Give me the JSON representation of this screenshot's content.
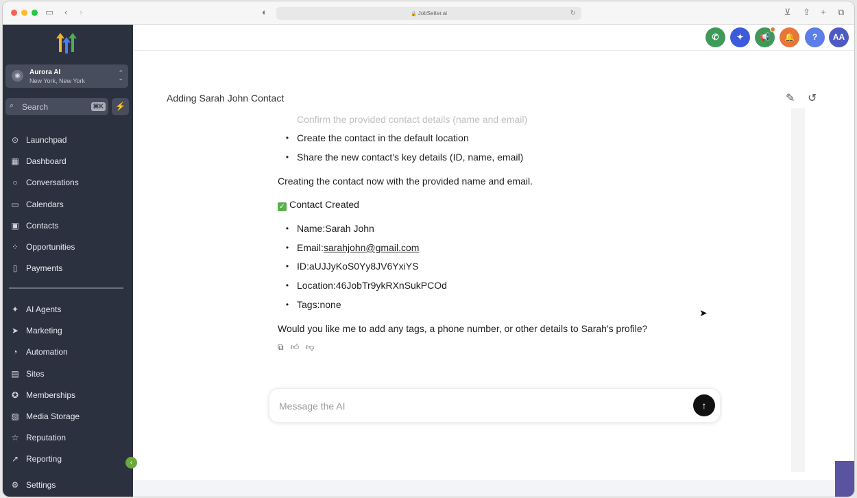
{
  "browser": {
    "url": "JobSetter.ai",
    "icons": [
      "sidebar-toggle-icon",
      "back-icon",
      "forward-icon",
      "shield-icon",
      "reload-icon",
      "download-icon",
      "share-icon",
      "new-tab-icon",
      "tabs-icon"
    ]
  },
  "account": {
    "name": "Aurora AI",
    "location": "New York, New York"
  },
  "search": {
    "placeholder": "Search",
    "shortcut": "⌘K"
  },
  "nav": {
    "primary": [
      {
        "label": "Launchpad",
        "icon": "rocket-icon",
        "glyph": "⊙"
      },
      {
        "label": "Dashboard",
        "icon": "dashboard-icon",
        "glyph": "▦"
      },
      {
        "label": "Conversations",
        "icon": "chat-icon",
        "glyph": "○"
      },
      {
        "label": "Calendars",
        "icon": "calendar-icon",
        "glyph": "▭"
      },
      {
        "label": "Contacts",
        "icon": "contacts-icon",
        "glyph": "▣"
      },
      {
        "label": "Opportunities",
        "icon": "opportunities-icon",
        "glyph": "⁘"
      },
      {
        "label": "Payments",
        "icon": "payments-icon",
        "glyph": "▯"
      }
    ],
    "secondary": [
      {
        "label": "AI Agents",
        "icon": "sparkle-icon",
        "glyph": "✦"
      },
      {
        "label": "Marketing",
        "icon": "send-icon",
        "glyph": "➤"
      },
      {
        "label": "Automation",
        "icon": "automation-icon",
        "glyph": "◔"
      },
      {
        "label": "Sites",
        "icon": "sites-icon",
        "glyph": "▤"
      },
      {
        "label": "Memberships",
        "icon": "award-icon",
        "glyph": "✪"
      },
      {
        "label": "Media Storage",
        "icon": "image-icon",
        "glyph": "▨"
      },
      {
        "label": "Reputation",
        "icon": "star-icon",
        "glyph": "☆"
      },
      {
        "label": "Reporting",
        "icon": "trend-icon",
        "glyph": "↗"
      }
    ],
    "settings": {
      "label": "Settings",
      "icon": "gear-icon",
      "glyph": "⚙"
    }
  },
  "topbar": {
    "buttons": [
      {
        "icon": "phone-icon",
        "glyph": "✆",
        "color": "#3f9a5a"
      },
      {
        "icon": "magic-icon",
        "glyph": "✦",
        "color": "#3b5bdb"
      },
      {
        "icon": "megaphone-icon",
        "glyph": "📢",
        "color": "#3f9a5a"
      },
      {
        "icon": "bell-icon",
        "glyph": "🔔",
        "color": "#e8763a"
      },
      {
        "icon": "help-icon",
        "glyph": "?",
        "color": "#5b7ee8"
      },
      {
        "icon": "avatar",
        "glyph": "AA",
        "color": "#4f5bc4"
      }
    ]
  },
  "chat": {
    "title": "Adding Sarah John Contact",
    "faded_line": "Confirm the provided contact details (name and email)",
    "plan": [
      "Create the contact in the default location",
      "Share the new contact's key details (ID, name, email)"
    ],
    "status": "Creating the contact now with the provided name and email.",
    "created_label": "Contact Created",
    "details": {
      "name_label": "Name: ",
      "name": "Sarah John",
      "email_label": "Email: ",
      "email": "sarahjohn@gmail.com",
      "id_label": "ID: ",
      "id": "aUJJyKoS0Yy8JV6YxiYS",
      "location_label": "Location: ",
      "location": "46JobTr9ykRXnSukPCOd",
      "tags_label": "Tags: ",
      "tags": "none"
    },
    "question": "Would you like me to add any tags, a phone number, or other details to Sarah's profile?"
  },
  "composer": {
    "placeholder": "Message the AI"
  }
}
